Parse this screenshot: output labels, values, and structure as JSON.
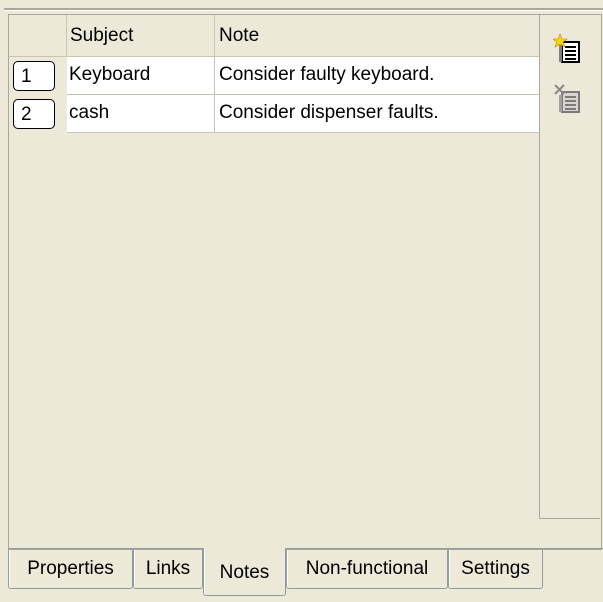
{
  "grid": {
    "columns": [
      "Subject",
      "Note"
    ],
    "rows": [
      {
        "num": "1",
        "subject": "Keyboard",
        "note": "Consider faulty keyboard."
      },
      {
        "num": "2",
        "subject": "cash",
        "note": "Consider dispenser faults."
      }
    ]
  },
  "toolbar": {
    "add_icon": "add-note-icon",
    "delete_icon": "delete-note-icon"
  },
  "tabs": [
    {
      "label": "Properties",
      "active": false
    },
    {
      "label": "Links",
      "active": false
    },
    {
      "label": "Notes",
      "active": true
    },
    {
      "label": "Non-functional",
      "active": false
    },
    {
      "label": "Settings",
      "active": false
    }
  ],
  "colors": {
    "background": "#ece9d8",
    "cell": "#ffffff",
    "grid_line": "#c8c4b4"
  }
}
